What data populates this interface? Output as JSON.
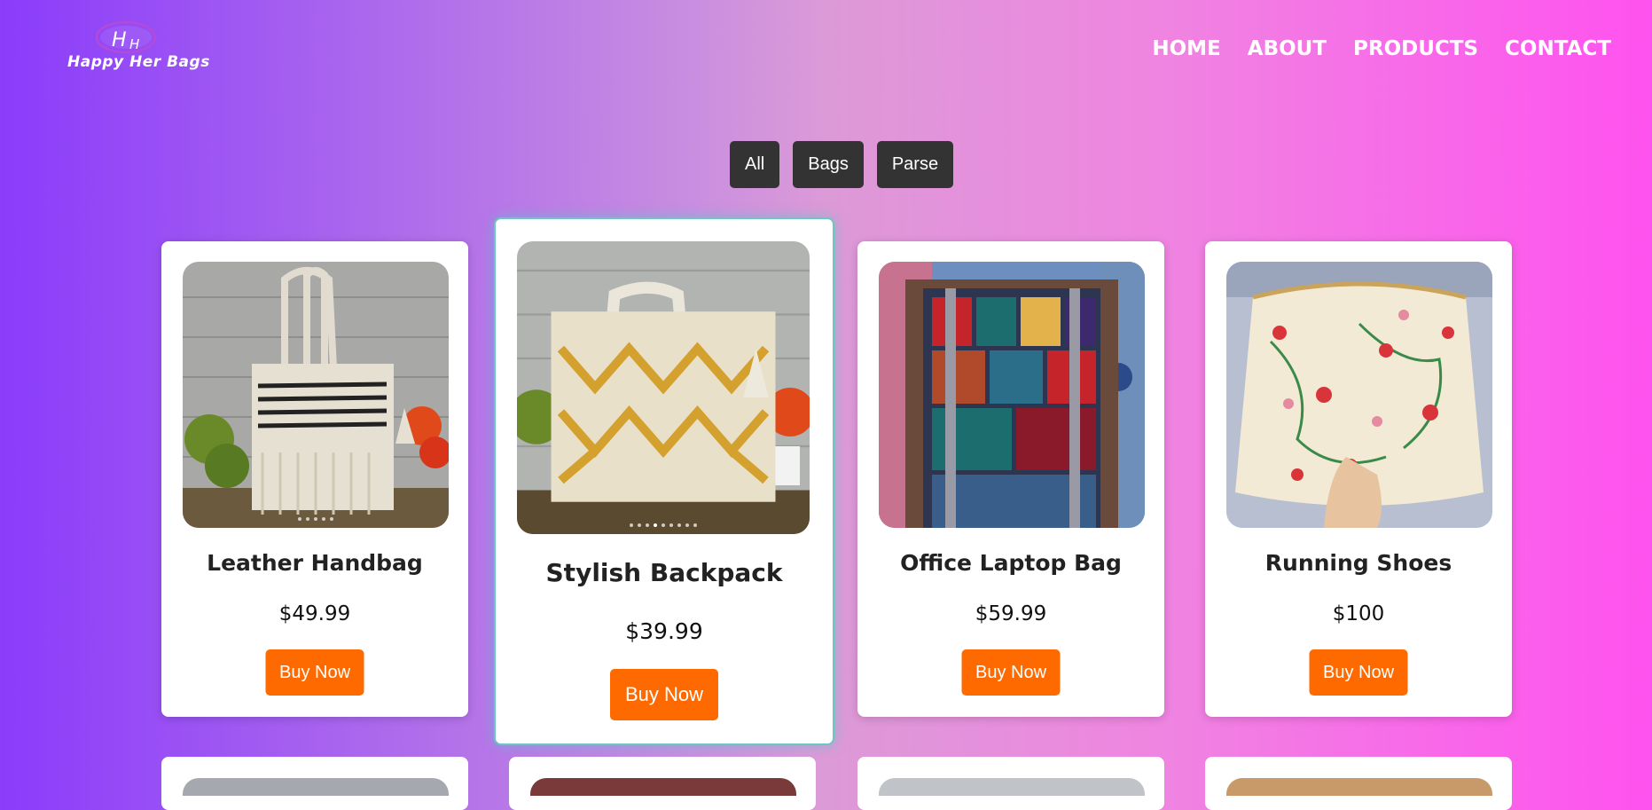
{
  "brand": {
    "logo_text": "Happy Her Bags",
    "monogram": "HH"
  },
  "nav": [
    "HOME",
    "ABOUT",
    "PRODUCTS",
    "CONTACT"
  ],
  "filters": [
    "All",
    "Bags",
    "Parse"
  ],
  "products": [
    {
      "name": "Leather Handbag",
      "price": "$49.99",
      "button": "Buy Now",
      "image": "white macrame tote bag"
    },
    {
      "name": "Stylish Backpack",
      "price": "$39.99",
      "button": "Buy Now",
      "image": "mustard woven tote bag"
    },
    {
      "name": "Office Laptop Bag",
      "price": "$59.99",
      "button": "Buy Now",
      "image": "patchwork backpack"
    },
    {
      "name": "Running Shoes",
      "price": "$100",
      "button": "Buy Now",
      "image": "floral embroidered purse"
    }
  ],
  "colors": {
    "accent": "#ff6a00",
    "filter_bg": "#333333",
    "highlight": "#6ec6c0"
  }
}
